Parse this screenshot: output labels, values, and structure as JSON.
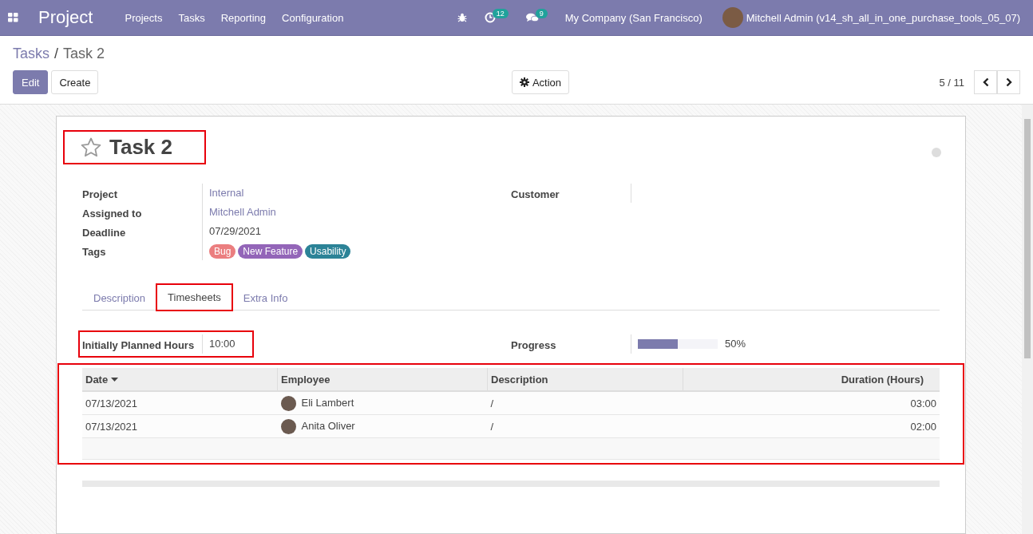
{
  "navbar": {
    "app_title": "Project",
    "menu": [
      "Projects",
      "Tasks",
      "Reporting",
      "Configuration"
    ],
    "activity_count": "12",
    "message_count": "9",
    "company": "My Company (San Francisco)",
    "user": "Mitchell Admin (v14_sh_all_in_one_purchase_tools_05_07)"
  },
  "breadcrumb": [
    {
      "label": "Tasks",
      "kind": "link"
    },
    {
      "label": "/",
      "kind": "separator"
    },
    {
      "label": "Task 2",
      "kind": "current"
    }
  ],
  "buttons": {
    "edit": "Edit",
    "create": "Create",
    "action": "Action"
  },
  "pager": "5 / 11",
  "task": {
    "title": "Task 2",
    "starred": false,
    "highlighted": true
  },
  "fields_left": [
    {
      "label": "Project",
      "value": "Internal",
      "kind": "link"
    },
    {
      "label": "Assigned to",
      "value": "Mitchell Admin",
      "kind": "link"
    },
    {
      "label": "Deadline",
      "value": "07/29/2021",
      "kind": "text"
    },
    {
      "label": "Tags",
      "kind": "tags",
      "tags": [
        {
          "label": "Bug",
          "color": "#eb7e7f"
        },
        {
          "label": "New Feature",
          "color": "#9365b8"
        },
        {
          "label": "Usability",
          "color": "#2c8397"
        }
      ]
    }
  ],
  "fields_right": [
    {
      "label": "Customer"
    }
  ],
  "tabs": [
    {
      "label": "Description",
      "selected": false,
      "highlighted": false
    },
    {
      "label": "Timesheets",
      "selected": true,
      "highlighted": true
    },
    {
      "label": "Extra Info",
      "selected": false,
      "highlighted": false
    }
  ],
  "planned_hours": {
    "label": "Initially Planned Hours",
    "value": "10:00",
    "highlighted": true
  },
  "progress": {
    "label": "Progress",
    "level": 0.5,
    "reading": "50%"
  },
  "timesheet": {
    "highlighted": true,
    "columns": [
      "Date",
      "Employee",
      "Description",
      "Duration (Hours)"
    ],
    "rows": [
      [
        "07/13/2021",
        "Eli Lambert",
        "/",
        "03:00"
      ],
      [
        "07/13/2021",
        "Anita Oliver",
        "/",
        "02:00"
      ]
    ]
  }
}
